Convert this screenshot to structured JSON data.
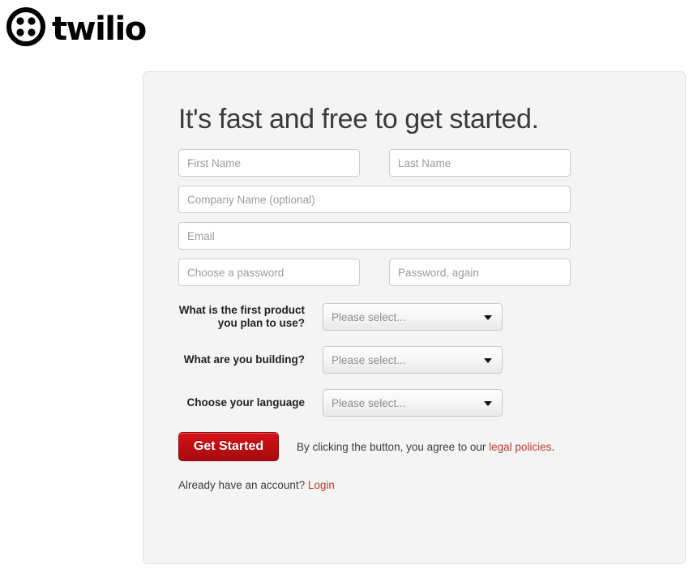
{
  "brand": {
    "name": "twilio",
    "logo_icon": "twilio-circle-four-dots-icon",
    "color": "#000000"
  },
  "signup": {
    "headline": "It's fast and free to get started.",
    "fields": {
      "first_name": {
        "placeholder": "First Name",
        "value": ""
      },
      "last_name": {
        "placeholder": "Last Name",
        "value": ""
      },
      "company_name": {
        "placeholder": "Company Name (optional)",
        "value": ""
      },
      "email": {
        "placeholder": "Email",
        "value": ""
      },
      "password": {
        "placeholder": "Choose a password",
        "value": ""
      },
      "password_confirm": {
        "placeholder": "Password, again",
        "value": ""
      }
    },
    "selects": [
      {
        "label_line1": "What is the first product",
        "label_line2": "you plan to use?",
        "value": "Please select...",
        "arrow_icon": "chevron-down-icon"
      },
      {
        "label_line1": "What are you building?",
        "label_line2": "",
        "value": "Please select...",
        "arrow_icon": "chevron-down-icon"
      },
      {
        "label_line1": "Choose your language",
        "label_line2": "",
        "value": "Please select...",
        "arrow_icon": "chevron-down-icon"
      }
    ],
    "submit_label": "Get Started",
    "terms_prefix": "By clicking the button, you agree to our ",
    "terms_link": "legal policies",
    "terms_suffix": ".",
    "login_prompt": "Already have an account? ",
    "login_link": "Login",
    "accent_color": "#c0392b",
    "button_color": "#c00d12"
  }
}
